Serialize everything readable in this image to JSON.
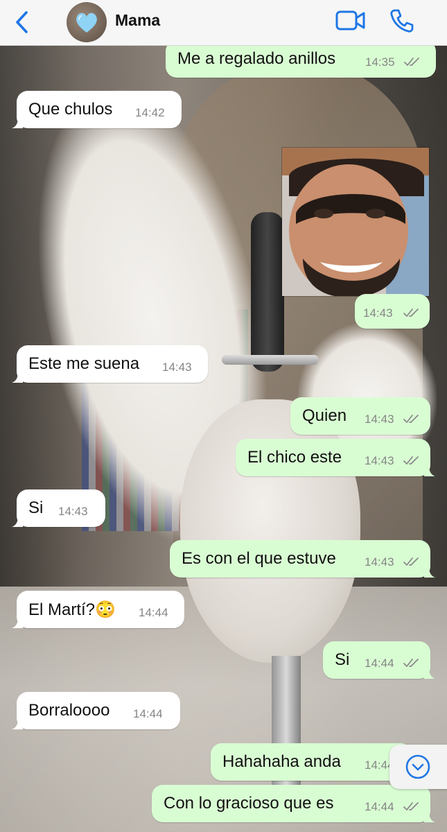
{
  "header": {
    "contact_name": "Mama"
  },
  "messages": [
    {
      "dir": "out",
      "text": "Me a regalado anillos",
      "time": "14:35",
      "read": true
    },
    {
      "dir": "in",
      "text": "Que chulos",
      "time": "14:42"
    },
    {
      "dir": "out",
      "type": "image",
      "time": "14:43",
      "read": true
    },
    {
      "dir": "in",
      "text": "Este me suena",
      "time": "14:43"
    },
    {
      "dir": "out",
      "text": "Quien",
      "time": "14:43",
      "read": true
    },
    {
      "dir": "out",
      "text": "El chico este",
      "time": "14:43",
      "read": true
    },
    {
      "dir": "in",
      "text": "Si",
      "time": "14:43"
    },
    {
      "dir": "out",
      "text": "Es con el que estuve",
      "time": "14:43",
      "read": true
    },
    {
      "dir": "in",
      "text": "El Martí?😳",
      "time": "14:44"
    },
    {
      "dir": "out",
      "text": "Si",
      "time": "14:44",
      "read": true
    },
    {
      "dir": "in",
      "text": "Borraloooo",
      "time": "14:44"
    },
    {
      "dir": "out",
      "text": "Hahahaha anda",
      "time": "14:44",
      "read": true
    },
    {
      "dir": "out",
      "text": "Con lo gracioso que es",
      "time": "14:44",
      "read": true
    }
  ],
  "colors": {
    "accent": "#1f76e5",
    "outgoing_bubble": "#d9fdd3",
    "incoming_bubble": "#ffffff",
    "read_ticks": "#8a8a8a"
  },
  "icons": {
    "back": "chevron-left-icon",
    "video_call": "video-camera-icon",
    "voice_call": "phone-icon",
    "scroll_down": "chevron-down-icon",
    "read_receipt": "double-check-icon",
    "avatar": "blue-heart-icon"
  }
}
